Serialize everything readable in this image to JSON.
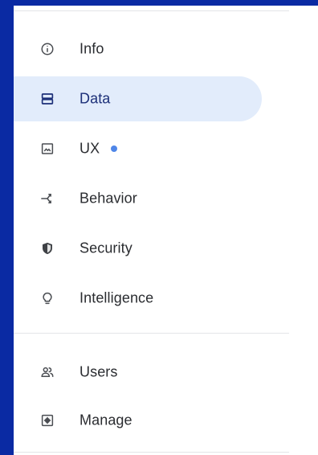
{
  "nav": {
    "items": [
      {
        "label": "Info",
        "icon": "info-icon"
      },
      {
        "label": "Data",
        "icon": "storage-icon",
        "active": true
      },
      {
        "label": "UX",
        "icon": "image-icon",
        "has_dot": true
      },
      {
        "label": "Behavior",
        "icon": "behavior-icon"
      },
      {
        "label": "Security",
        "icon": "shield-icon"
      },
      {
        "label": "Intelligence",
        "icon": "lightbulb-icon"
      }
    ],
    "secondary_items": [
      {
        "label": "Users",
        "icon": "users-icon"
      },
      {
        "label": "Manage",
        "icon": "manage-icon"
      }
    ]
  },
  "colors": {
    "frame": "#0a2aa3",
    "active_background": "#e2ecfb",
    "dot": "#4f86e8",
    "icon": "#4a4d52"
  }
}
